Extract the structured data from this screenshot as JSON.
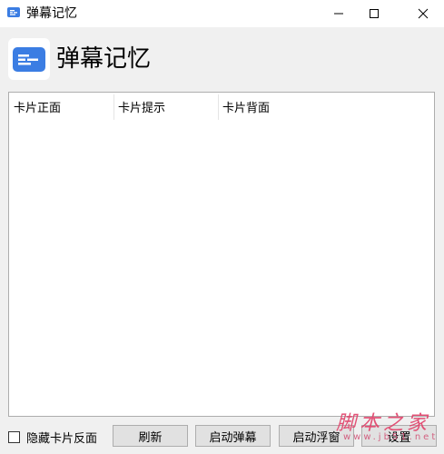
{
  "window": {
    "title": "弹幕记忆"
  },
  "header": {
    "title": "弹幕记忆"
  },
  "list": {
    "columns": [
      "卡片正面",
      "卡片提示",
      "卡片背面"
    ]
  },
  "footer": {
    "hide_back_label": "隐藏卡片反面",
    "hide_back_checked": false,
    "refresh_label": "刷新",
    "start_danmu_label": "启动弹幕",
    "start_float_label": "启动浮窗",
    "settings_label": "设置"
  },
  "watermark": {
    "main": "脚本之家",
    "site": "www.jb51.net"
  },
  "colors": {
    "accent": "#3b7de3",
    "titlebar": "#ffffff",
    "window_bg": "#f0f0f0",
    "button_bg": "#e1e1e1",
    "button_border": "#adadad",
    "watermark": "#e13f68"
  },
  "icons": {
    "app": "message-card-icon",
    "minimize": "minimize-icon",
    "maximize": "maximize-icon",
    "close": "close-icon"
  }
}
